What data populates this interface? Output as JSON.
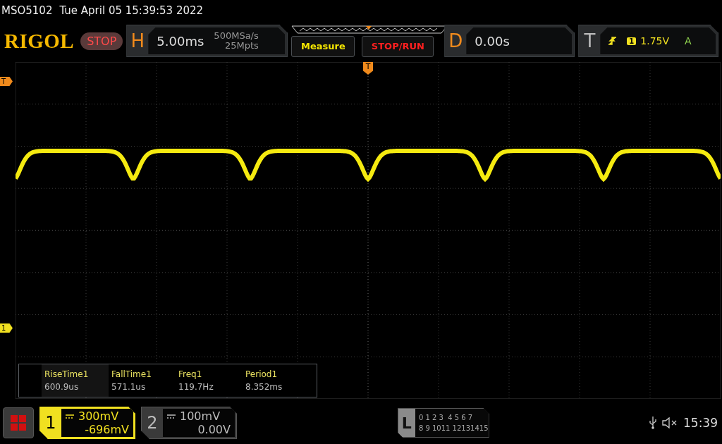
{
  "header": {
    "model": "MSO5102",
    "datetime": "Tue April 05 15:39:53 2022"
  },
  "toolbar": {
    "logo": "RIGOL",
    "run_state": "STOP",
    "horizontal": {
      "letter": "H",
      "scale": "5.00ms",
      "sample_rate": "500MSa/s",
      "memory_depth": "25Mpts"
    },
    "buttons": [
      {
        "label": "Measure",
        "kind": "measure"
      },
      {
        "label": "STOP/RUN",
        "kind": "run"
      }
    ],
    "delay": {
      "letter": "D",
      "value": "0.00s"
    },
    "trigger": {
      "letter": "T",
      "source": "1",
      "level": "1.75V",
      "mode": "A"
    }
  },
  "screen": {
    "trigger_marker": "T",
    "level_marker": "T",
    "channel_marker": "1"
  },
  "measurements": [
    {
      "name": "RiseTime1",
      "value": "600.9us",
      "selected": true
    },
    {
      "name": "FallTime1",
      "value": "571.1us",
      "selected": false
    },
    {
      "name": "Freq1",
      "value": "119.7Hz",
      "selected": false
    },
    {
      "name": "Period1",
      "value": "8.352ms",
      "selected": false
    }
  ],
  "channels": [
    {
      "number": "1",
      "scale": "300mV",
      "offset": "-696mV",
      "selected": true
    },
    {
      "number": "2",
      "scale": "100mV",
      "offset": "0.00V",
      "selected": false
    }
  ],
  "logic": {
    "letter": "L",
    "row_1": "0 1 2 3  4 5 6 7",
    "row_2": "8 9 1011 12131415"
  },
  "status": {
    "time": "15:39"
  }
}
